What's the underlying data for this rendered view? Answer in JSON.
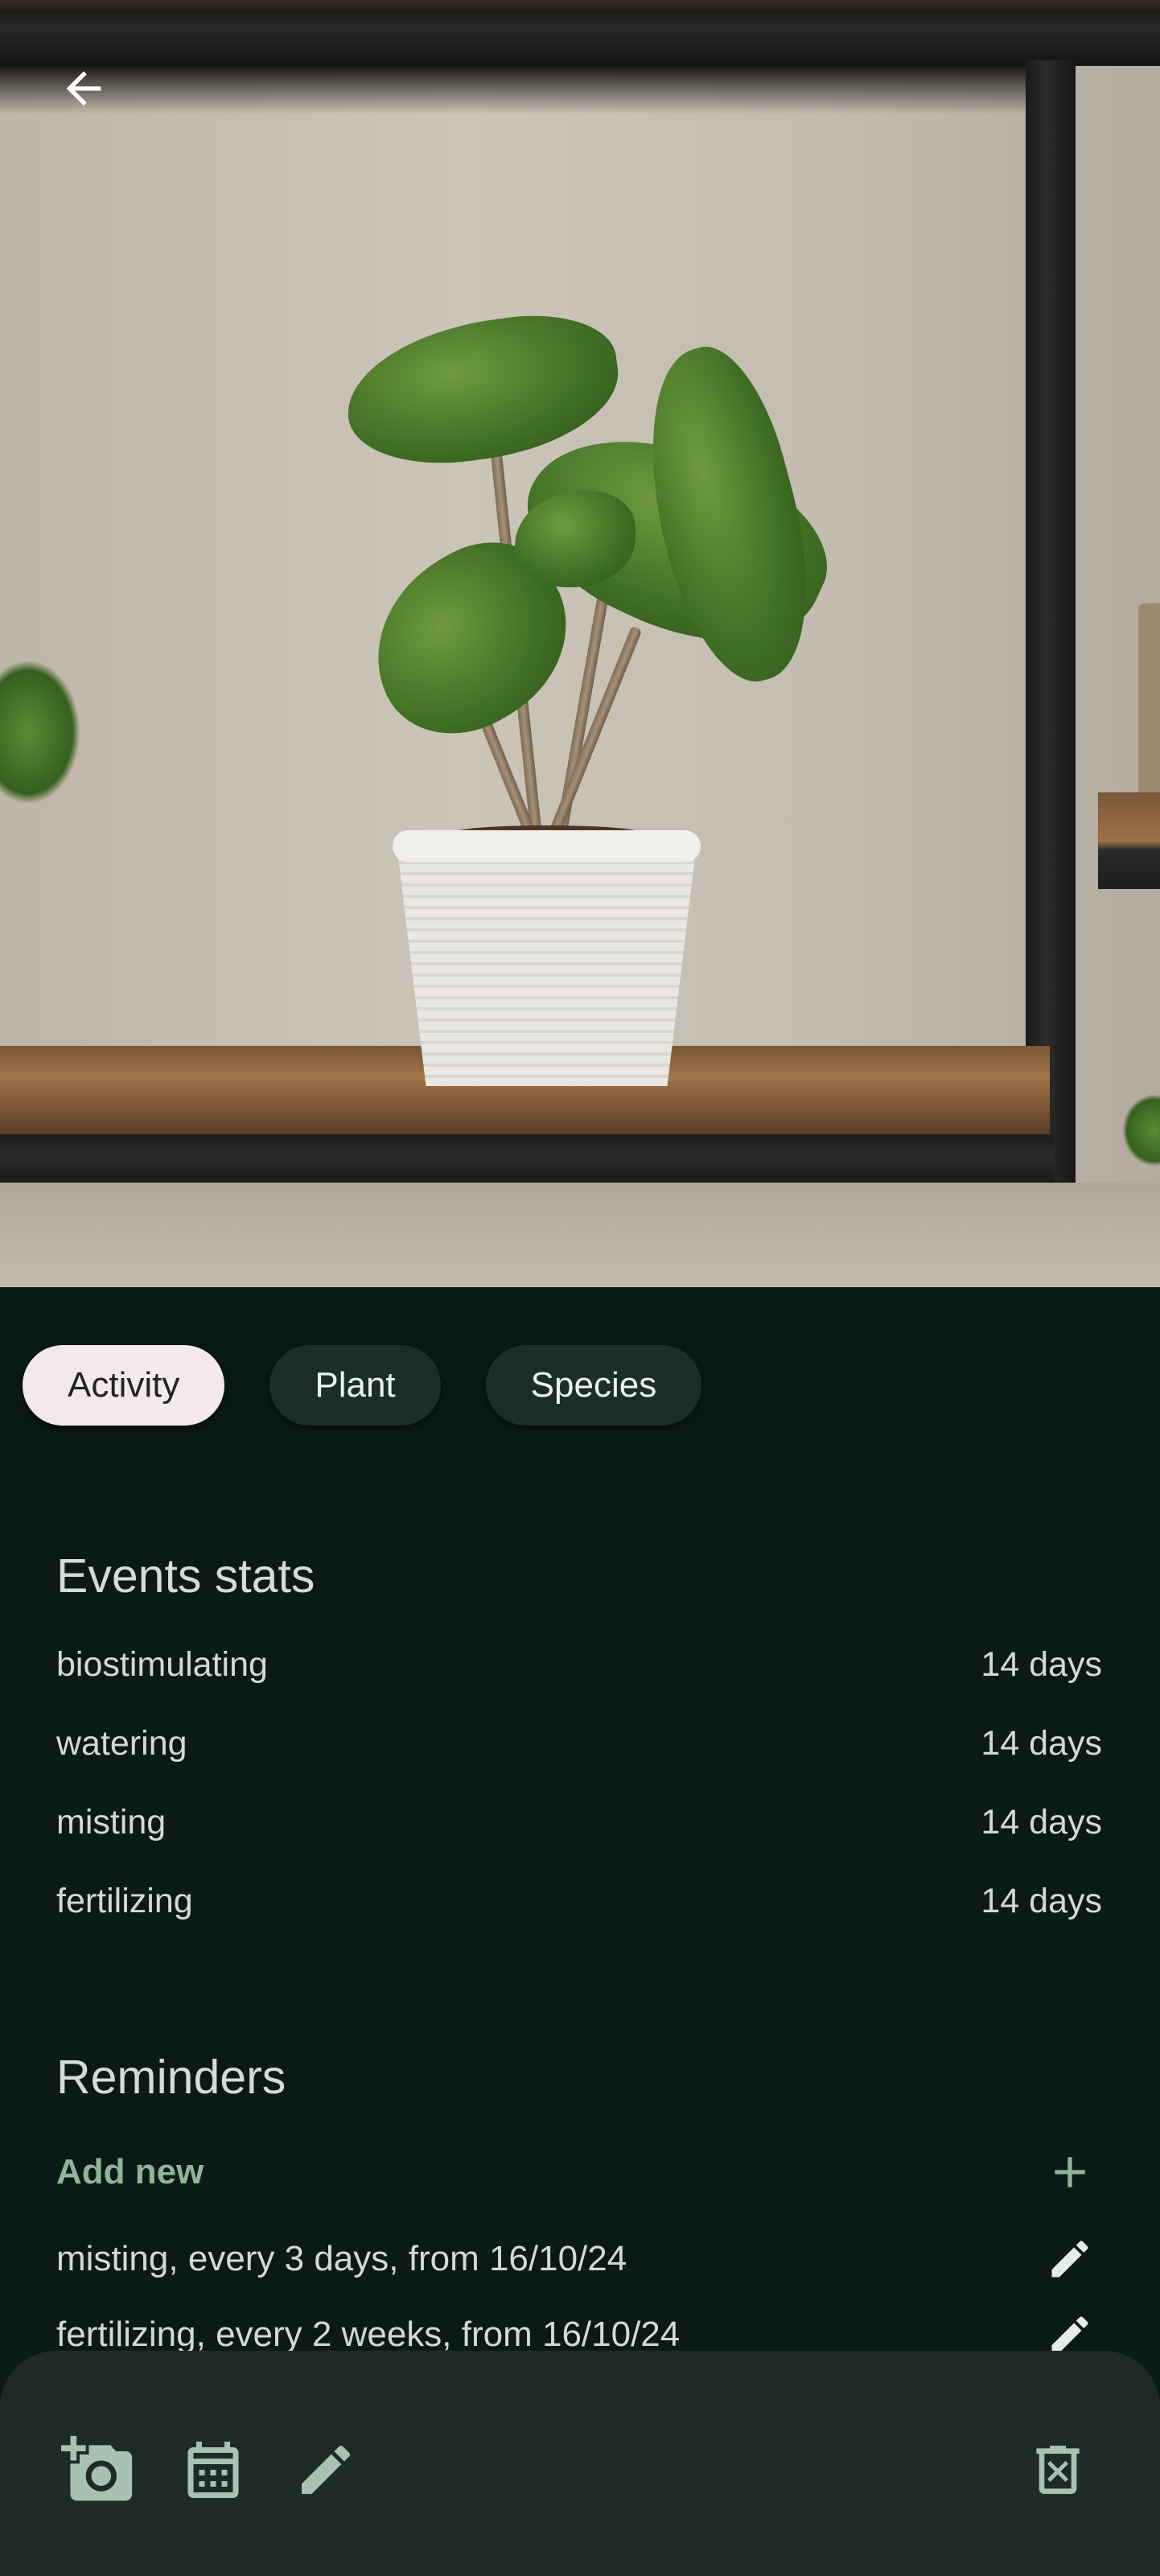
{
  "header": {
    "back_icon": "arrow-back-icon"
  },
  "tabs": [
    {
      "label": "Activity",
      "active": true
    },
    {
      "label": "Plant",
      "active": false
    },
    {
      "label": "Species",
      "active": false
    }
  ],
  "events_stats": {
    "title": "Events stats",
    "rows": [
      {
        "label": "biostimulating",
        "value": "14 days"
      },
      {
        "label": "watering",
        "value": "14 days"
      },
      {
        "label": "misting",
        "value": "14 days"
      },
      {
        "label": "fertilizing",
        "value": "14 days"
      }
    ]
  },
  "reminders": {
    "title": "Reminders",
    "add_label": "Add new",
    "add_icon": "plus-icon",
    "items": [
      {
        "text": "misting, every 3 days, from 16/10/24",
        "icon": "pencil-icon"
      },
      {
        "text": "fertilizing, every 2 weeks, from 16/10/24",
        "icon": "pencil-icon"
      }
    ]
  },
  "bottom_bar": {
    "icons": [
      "add-photo-icon",
      "calendar-icon",
      "edit-icon",
      "delete-icon"
    ]
  },
  "colors": {
    "background": "#0b1a16",
    "chip": "#1c2e2a",
    "chip_active": "#f3e8ea",
    "accent": "#8fb49a",
    "bottom_bar": "#1e2b28"
  }
}
